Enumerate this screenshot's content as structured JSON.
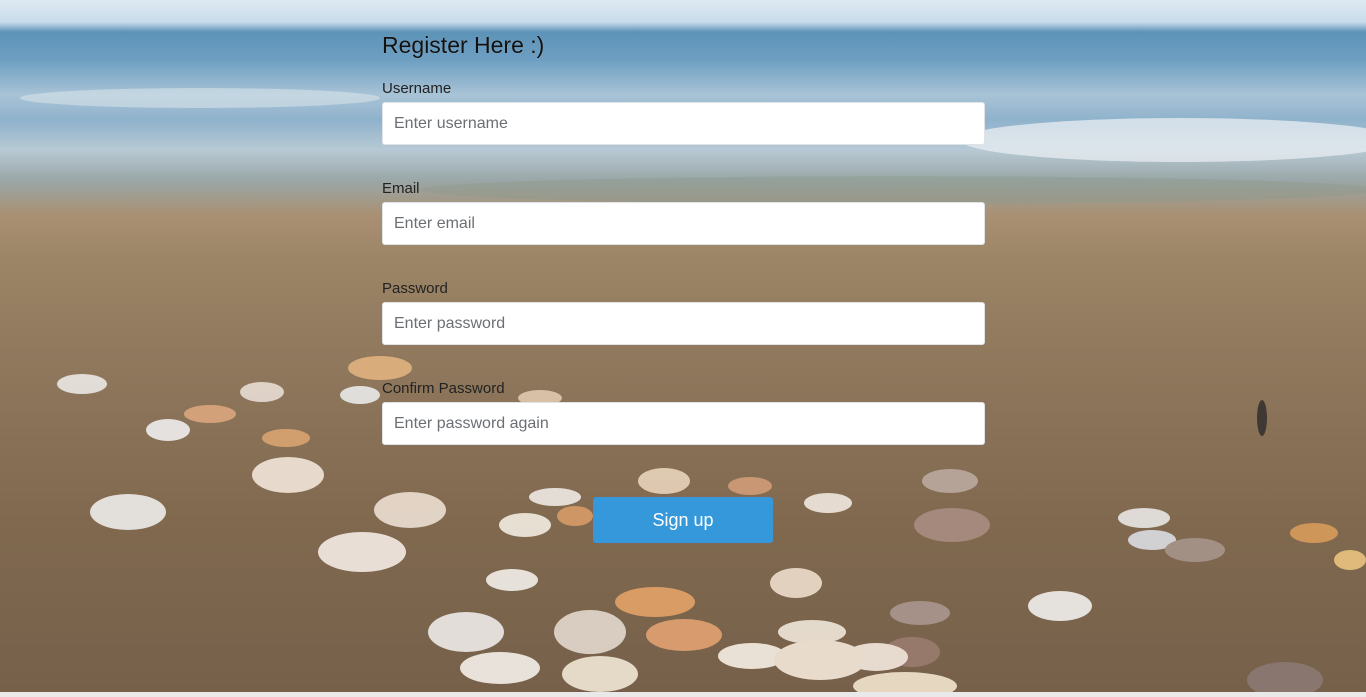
{
  "form": {
    "title": "Register Here :)",
    "username": {
      "label": "Username",
      "placeholder": "Enter username",
      "value": ""
    },
    "email": {
      "label": "Email",
      "placeholder": "Enter email",
      "value": ""
    },
    "password": {
      "label": "Password",
      "placeholder": "Enter password",
      "value": ""
    },
    "confirm_password": {
      "label": "Confirm Password",
      "placeholder": "Enter password again",
      "value": ""
    },
    "submit_label": "Sign up"
  },
  "colors": {
    "accent": "#3498db",
    "field_background": "#ffffff",
    "text": "#111111"
  }
}
